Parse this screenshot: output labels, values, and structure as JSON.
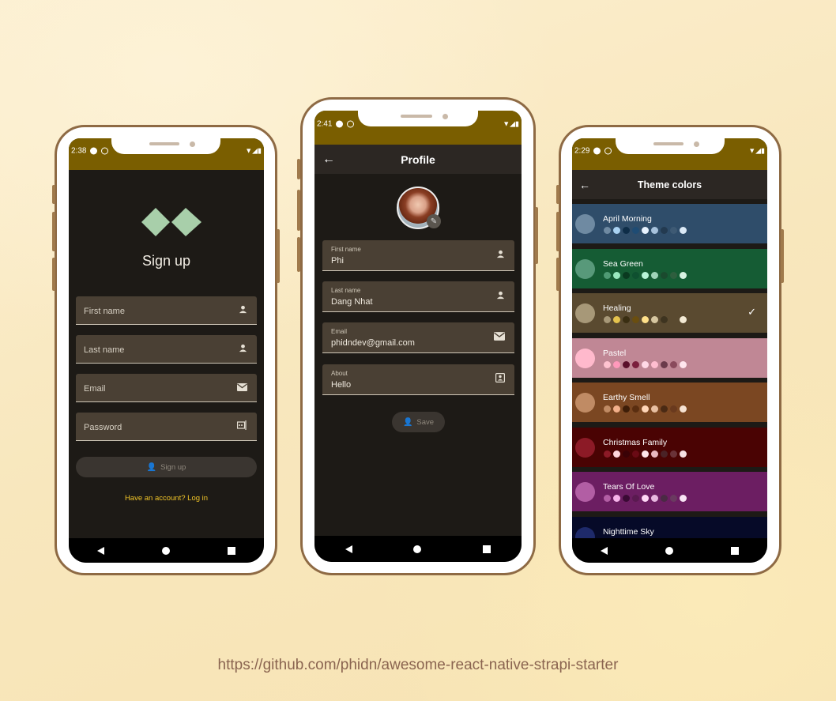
{
  "signup_screen": {
    "status_time": "2:38",
    "title": "Sign up",
    "fields": [
      {
        "label": "First name",
        "icon": "person-icon"
      },
      {
        "label": "Last name",
        "icon": "person-icon"
      },
      {
        "label": "Email",
        "icon": "mail-icon"
      },
      {
        "label": "Password",
        "icon": "password-icon"
      }
    ],
    "signup_button": "Sign up",
    "login_link": "Have an account? Log in",
    "logo_color": "#a8cfaa"
  },
  "profile_screen": {
    "status_time": "2:41",
    "title": "Profile",
    "fields": [
      {
        "label": "First name",
        "value": "Phi",
        "icon": "person-icon"
      },
      {
        "label": "Last name",
        "value": "Dang Nhat",
        "icon": "person-icon"
      },
      {
        "label": "Email",
        "value": "phidndev@gmail.com",
        "icon": "mail-icon"
      },
      {
        "label": "About",
        "value": "Hello",
        "icon": "contact-card-icon"
      }
    ],
    "save_button": "Save"
  },
  "themes_screen": {
    "status_time": "2:29",
    "title": "Theme colors",
    "selected": "Healing",
    "themes": [
      {
        "name": "April Morning",
        "bg": "#2f4d6a",
        "circle": "#6f8aa2",
        "dots": [
          "#6f8aa2",
          "#a9d2f2",
          "#0e2d48",
          "#1f4c74",
          "#e8f3ff",
          "#a7c2dc",
          "#233a50",
          "#3e5a74",
          "#dbe9f6"
        ]
      },
      {
        "name": "Sea Green",
        "bg": "#155c34",
        "circle": "#58997a",
        "dots": [
          "#4f9a74",
          "#9ae8bf",
          "#0a3a20",
          "#0f5030",
          "#b8f5d8",
          "#9fd3b8",
          "#1a4a2e",
          "#2e5e3e",
          "#d7f2e2"
        ]
      },
      {
        "name": "Healing",
        "bg": "#5a4a30",
        "circle": "#a79878",
        "dots": [
          "#a79878",
          "#e5c34e",
          "#3a2e12",
          "#6a4e10",
          "#ffe08a",
          "#d6c6a0",
          "#3e3420",
          "#5a4a30",
          "#f3ead4"
        ]
      },
      {
        "name": "Pastel",
        "bg": "#c08795",
        "circle": "#ffb9cc",
        "dots": [
          "#ffc3d0",
          "#ff99bb",
          "#5a0f2a",
          "#7a1e3c",
          "#ffd9e6",
          "#ffbed0",
          "#6a3a4a",
          "#8a4a5c",
          "#ffe6ee"
        ]
      },
      {
        "name": "Earthy Smell",
        "bg": "#7b4722",
        "circle": "#c08b64",
        "dots": [
          "#c08b64",
          "#f2b08a",
          "#3e1e08",
          "#5a2e10",
          "#ffd6b8",
          "#e8c0a2",
          "#4a2a14",
          "#6a3a1e",
          "#f6e2d2"
        ]
      },
      {
        "name": "Christmas Family",
        "bg": "#4a0303",
        "circle": "#8c1a26",
        "dots": [
          "#8c1a26",
          "#ffd6dc",
          "#3a0206",
          "#6a0a14",
          "#ffe6ea",
          "#e8b8c0",
          "#4a2226",
          "#6a3238",
          "#f6e0e4"
        ]
      },
      {
        "name": "Tears Of Love",
        "bg": "#6c1e62",
        "circle": "#b25ea4",
        "dots": [
          "#b25ea4",
          "#f6b4ea",
          "#3a0a34",
          "#5a1a50",
          "#ffd8f6",
          "#e8b8e0",
          "#4a2a44",
          "#6a3a60",
          "#f8e4f4"
        ]
      },
      {
        "name": "Nighttime Sky",
        "bg": "#060a28",
        "circle": "#1e2a6a",
        "dots": []
      }
    ]
  },
  "footer": {
    "url": "https://github.com/phidn/awesome-react-native-strapi-starter"
  },
  "colors": {
    "status_bar": "#7a5e00",
    "screen_bg": "#1d1a16",
    "field_bg": "#4a4034",
    "link_yellow": "#f0c428",
    "phone_border": "#8e6a44"
  }
}
